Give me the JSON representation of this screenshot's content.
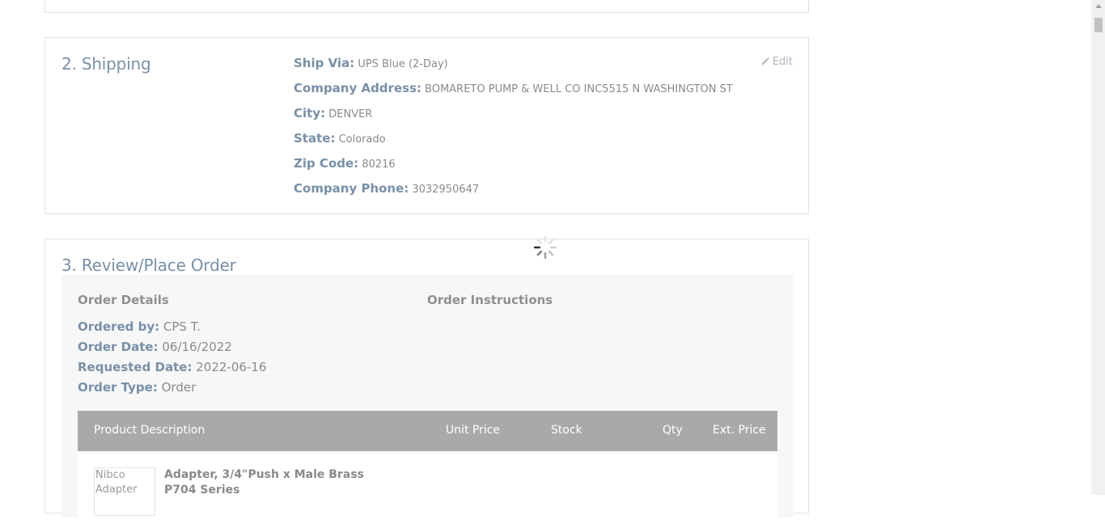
{
  "shipping": {
    "title": "2. Shipping",
    "edit_label": "Edit",
    "ship_via_label": "Ship Via:",
    "ship_via": "UPS Blue (2-Day)",
    "company_address_label": "Company Address:",
    "company_address": "BOMARETO PUMP & WELL CO INC5515 N WASHINGTON ST",
    "city_label": "City:",
    "city": "DENVER",
    "state_label": "State:",
    "state": "Colorado",
    "zip_label": "Zip Code:",
    "zip": "80216",
    "phone_label": "Company Phone:",
    "phone": "3032950647"
  },
  "review": {
    "title": "3. Review/Place Order",
    "order_details_heading": "Order Details",
    "order_instructions_heading": "Order Instructions",
    "ordered_by_label": "Ordered by:",
    "ordered_by": "CPS T.",
    "order_date_label": "Order Date:",
    "order_date": "06/16/2022",
    "requested_date_label": "Requested Date:",
    "requested_date": "2022-06-16",
    "order_type_label": "Order Type:",
    "order_type": "Order",
    "table": {
      "headers": {
        "product_description": "Product Description",
        "unit_price": "Unit Price",
        "stock": "Stock",
        "qty": "Qty",
        "ext_price": "Ext. Price"
      },
      "rows": [
        {
          "image_alt": "Nibco Adapter",
          "description": "Adapter, 3/4\"Push x Male Brass P704 Series"
        }
      ]
    }
  },
  "icons": {
    "edit": "pencil-icon",
    "loading": "spinner-icon"
  }
}
